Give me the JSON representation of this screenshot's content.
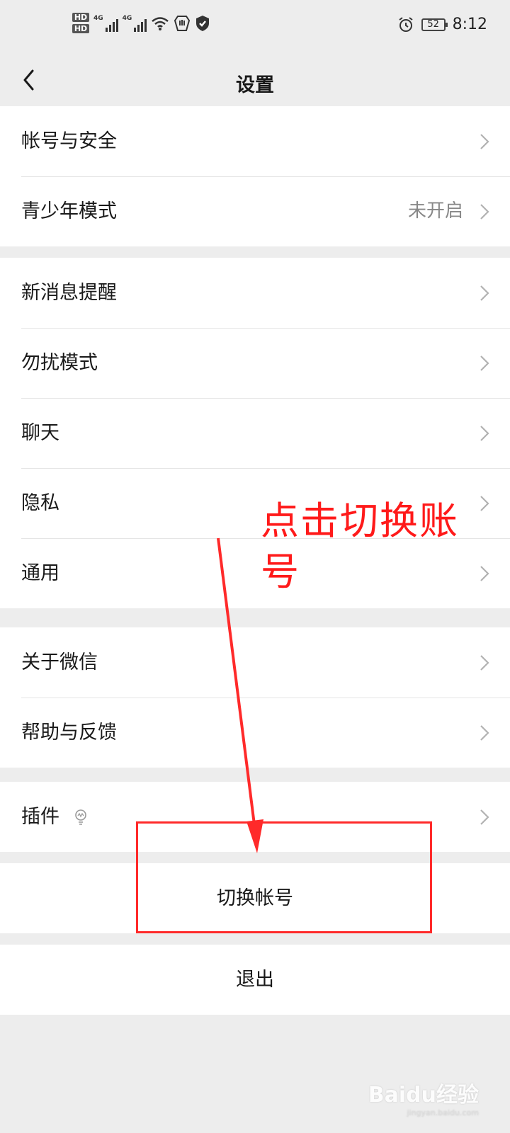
{
  "status_bar": {
    "hd1": "HD",
    "hd2": "HD",
    "net1": "4G",
    "net2": "4G",
    "battery": "52",
    "time": "8:12"
  },
  "nav": {
    "title": "设置",
    "back_icon": "back-arrow-icon"
  },
  "groups": [
    {
      "items": [
        {
          "label": "帐号与安全",
          "value": ""
        },
        {
          "label": "青少年模式",
          "value": "未开启"
        }
      ]
    },
    {
      "items": [
        {
          "label": "新消息提醒",
          "value": ""
        },
        {
          "label": "勿扰模式",
          "value": ""
        },
        {
          "label": "聊天",
          "value": ""
        },
        {
          "label": "隐私",
          "value": ""
        },
        {
          "label": "通用",
          "value": ""
        }
      ]
    },
    {
      "items": [
        {
          "label": "关于微信",
          "value": ""
        },
        {
          "label": "帮助与反馈",
          "value": ""
        }
      ]
    },
    {
      "items": [
        {
          "label": "插件",
          "value": "",
          "icon": "lightbulb-icon"
        }
      ]
    }
  ],
  "actions": {
    "switch_account": "切换帐号",
    "logout": "退出"
  },
  "annotation": {
    "text": "点击切换账号",
    "color": "#ff1a1a"
  },
  "watermark": {
    "text": "Baidu经验",
    "sub": "jingyan.baidu.com"
  }
}
